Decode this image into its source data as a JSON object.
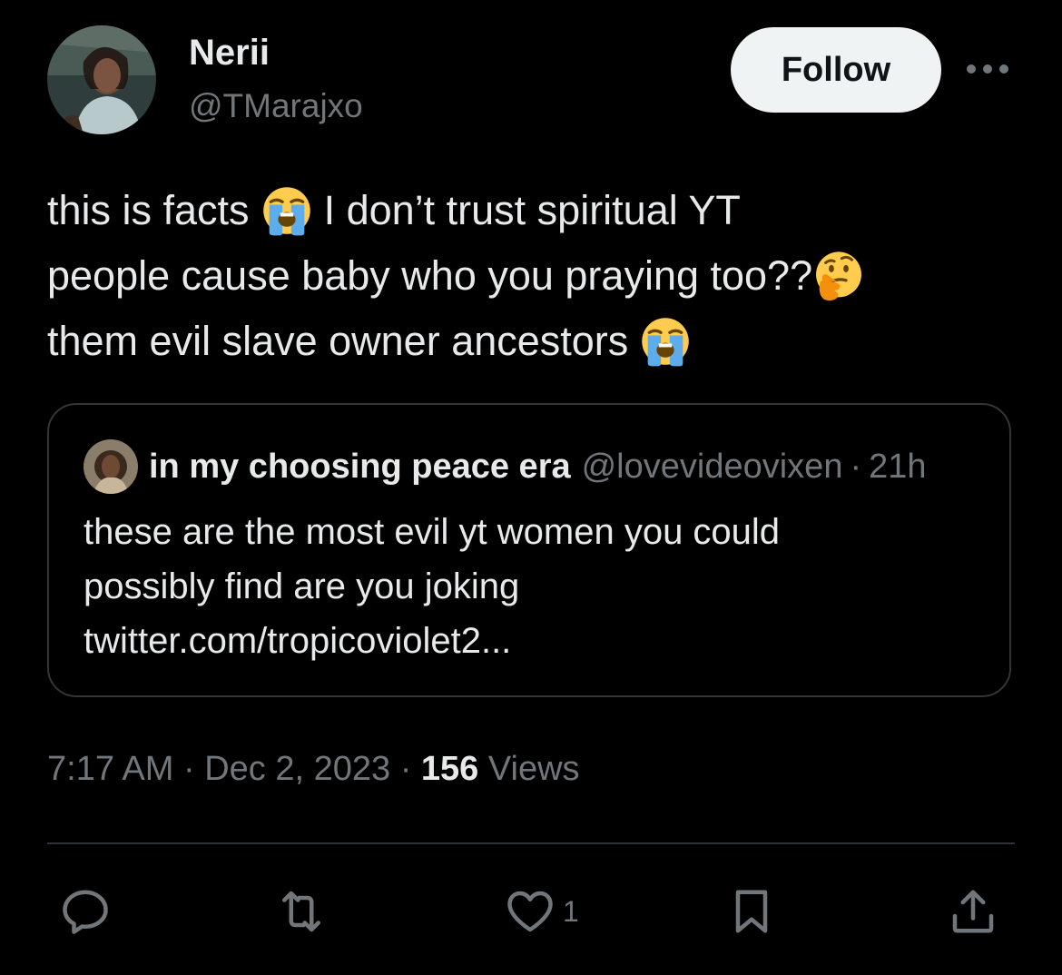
{
  "author": {
    "name": "Nerii",
    "handle": "@TMarajxo",
    "avatar_icon": "profile-photo-avatar"
  },
  "header": {
    "follow_label": "Follow",
    "more_icon": "more-dots-icon"
  },
  "tweet": {
    "lines": [
      {
        "before": "this is facts",
        "emoji": "loudly-crying-face-emoji",
        "after": "I don’t trust spiritual YT"
      },
      {
        "before": "people cause baby who you praying too??",
        "emoji": "thinking-face-emoji",
        "after": ""
      },
      {
        "before": "them evil slave owner ancestors",
        "emoji": "loudly-crying-face-emoji",
        "after": ""
      }
    ]
  },
  "quote": {
    "name": "in my choosing peace era",
    "handle": "@lovevideovixen",
    "separator": "·",
    "time": "21h",
    "text_lines": [
      "these are the most evil yt women you could",
      "possibly find are you joking",
      "twitter.com/tropicoviolet2..."
    ]
  },
  "meta": {
    "time": "7:17 AM",
    "sep1": "·",
    "date": "Dec 2, 2023",
    "sep2": "·",
    "views_count": "156",
    "views_label": "Views"
  },
  "actions": {
    "reply_icon": "reply-icon",
    "retweet_icon": "retweet-icon",
    "like_icon": "heart-icon",
    "like_count": "1",
    "bookmark_icon": "bookmark-icon",
    "share_icon": "share-icon"
  },
  "colors": {
    "background": "#000000",
    "primary_text": "#e7e9ea",
    "secondary_text": "#71767b",
    "border": "#333639",
    "follow_bg": "#eff3f4",
    "emoji_yellow": "#ffcc4d",
    "emoji_tears": "#5dadec"
  }
}
